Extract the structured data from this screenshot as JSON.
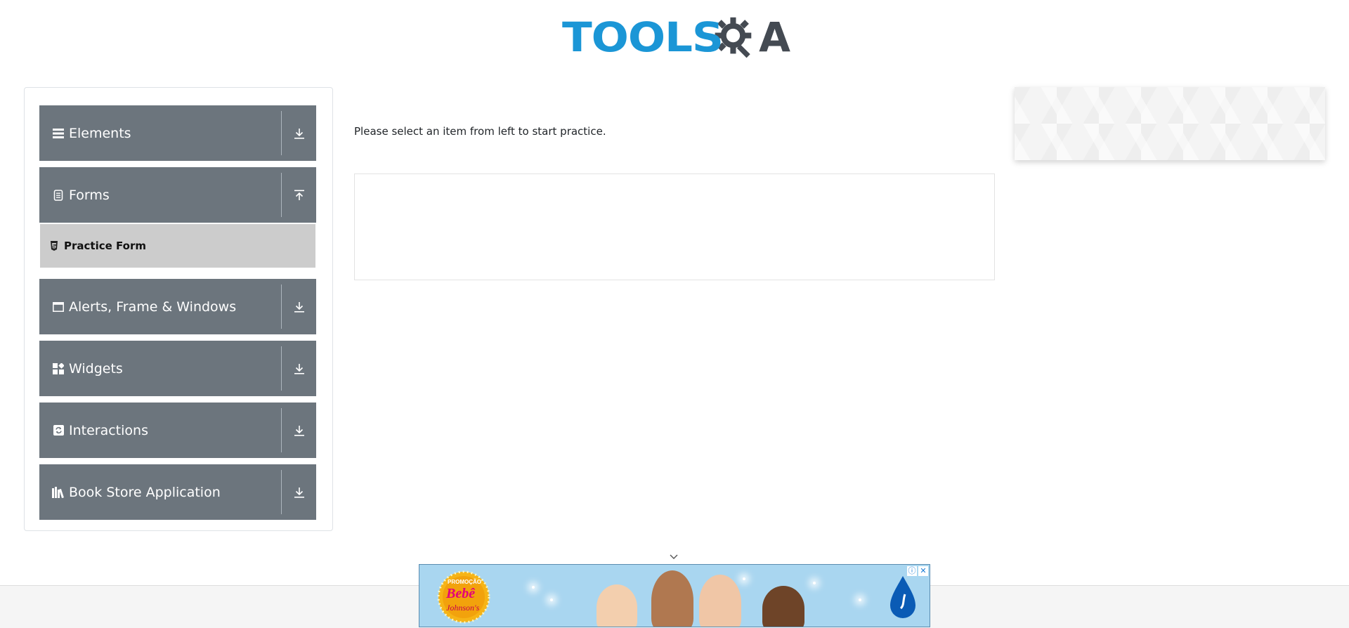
{
  "header": {
    "logo_text_left": "TOOLS",
    "logo_text_right": "A",
    "brand_color": "#1b96d6"
  },
  "sidebar": {
    "groups": [
      {
        "label": "Elements",
        "icon": "hamburger-icon",
        "expanded": false
      },
      {
        "label": "Forms",
        "icon": "document-icon",
        "expanded": true
      },
      {
        "label": "Alerts, Frame & Windows",
        "icon": "window-icon",
        "expanded": false
      },
      {
        "label": "Widgets",
        "icon": "widgets-icon",
        "expanded": false
      },
      {
        "label": "Interactions",
        "icon": "refresh-icon",
        "expanded": false
      },
      {
        "label": "Book Store Application",
        "icon": "books-icon",
        "expanded": false
      }
    ],
    "forms_items": [
      {
        "label": "Practice Form",
        "icon": "html5-icon"
      }
    ]
  },
  "main": {
    "prompt": "Please select an item from left to start practice."
  },
  "ad": {
    "badge_top": "PROMOÇÃO",
    "badge_mid": "Bebê",
    "badge_bottom": "Johnson's",
    "info_glyph": "ⓘ",
    "close_glyph": "✕"
  },
  "colors": {
    "group_bg": "#6c757d",
    "active_item_bg": "#cccccc",
    "ad_bg": "#a9d6f0"
  }
}
